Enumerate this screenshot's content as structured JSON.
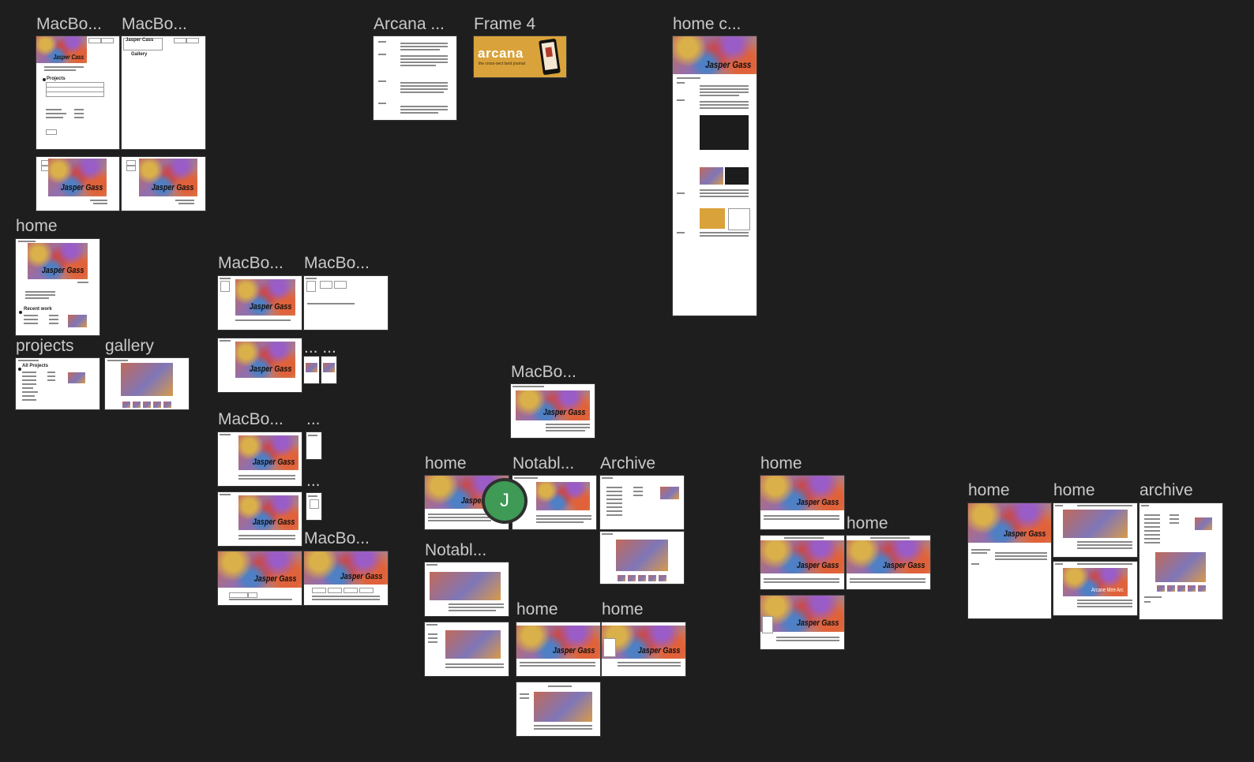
{
  "canvas": {
    "background": "#1e1e1e",
    "label_color": "#c9c9c9"
  },
  "frames": {
    "macbook_1": "MacBo...",
    "macbook_2": "MacBo...",
    "arcana": "Arcana ...",
    "frame_4": "Frame 4",
    "home_c": "home c...",
    "home_left": "home",
    "projects": "projects",
    "gallery": "gallery",
    "macbook_3": "MacBo...",
    "macbook_4": "MacBo...",
    "ellipsis_pair": "... ...",
    "macbook_5": "MacBo...",
    "ellipsis_1": "...",
    "ellipsis_2": "...",
    "macbook_6": "MacBo...",
    "macbook_center": "MacBo...",
    "home_mid": "home",
    "notable_1": "Notabl...",
    "archive_mid": "Archive",
    "notable_2": "Notabl...",
    "home_bottom_1": "home",
    "home_bottom_2": "home",
    "home_right_1": "home",
    "home_right_2": "home",
    "home_far_1": "home",
    "home_far_2": "home",
    "archive_far": "archive"
  },
  "content": {
    "hero_name": "Jasper Gass",
    "hero_name_alt": "Jasper Cass",
    "arcana_logo": "arcana",
    "arcana_tagline": "the cross-sect tarot journal",
    "recent_work": "Recent work",
    "all_projects": "All Projects",
    "projects_label": "Projects",
    "gallery_label": "Gallery",
    "alt_caption": "Arcane Mire Arc"
  },
  "collaborator": {
    "initial": "J",
    "color": "#3e9a55"
  }
}
